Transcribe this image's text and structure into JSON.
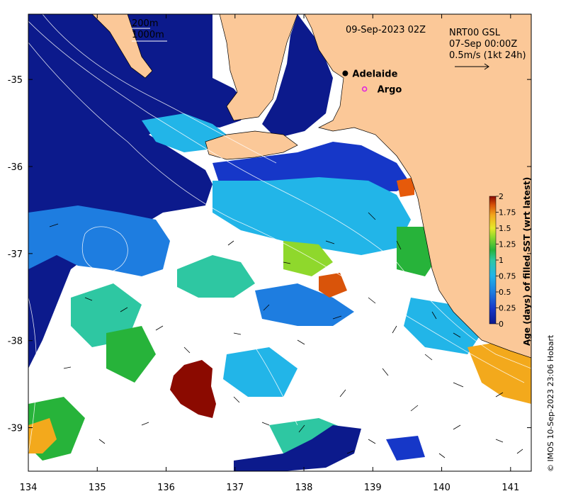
{
  "map": {
    "title": "09-Sep-2023 02Z",
    "contours": [
      "200m",
      "1000m"
    ],
    "current_box": {
      "line1": "NRT00 GSL",
      "line2": "07-Sep 00:00Z",
      "line3": "0.5m/s (1kt 24h)"
    },
    "places": [
      {
        "name": "Adelaide",
        "lon": 138.6,
        "lat": -34.93
      },
      {
        "name": "Argo",
        "lon": 138.88,
        "lat": -35.11
      }
    ],
    "x_ticks": [
      "134",
      "135",
      "136",
      "137",
      "138",
      "139",
      "140",
      "141"
    ],
    "y_ticks": [
      "-35",
      "-36",
      "-37",
      "-38",
      "-39"
    ],
    "lon_range": [
      134.0,
      141.3
    ],
    "lat_range": [
      -39.5,
      -34.25
    ],
    "colorbar": {
      "label": "Age (days) of filled SST (wrt latest)",
      "ticks": [
        "0",
        "0.25",
        "0.5",
        "0.75",
        "1",
        "1.25",
        "1.5",
        "1.75",
        "2"
      ],
      "range": [
        0,
        2
      ]
    },
    "credit": "© IMOS 10-Sep-2023 23:06 Hobart",
    "colors": {
      "land": "#fbc898",
      "age_0": "#0c1a8c",
      "age_2": "#8b0a00",
      "no_data": "#ffffff"
    }
  }
}
